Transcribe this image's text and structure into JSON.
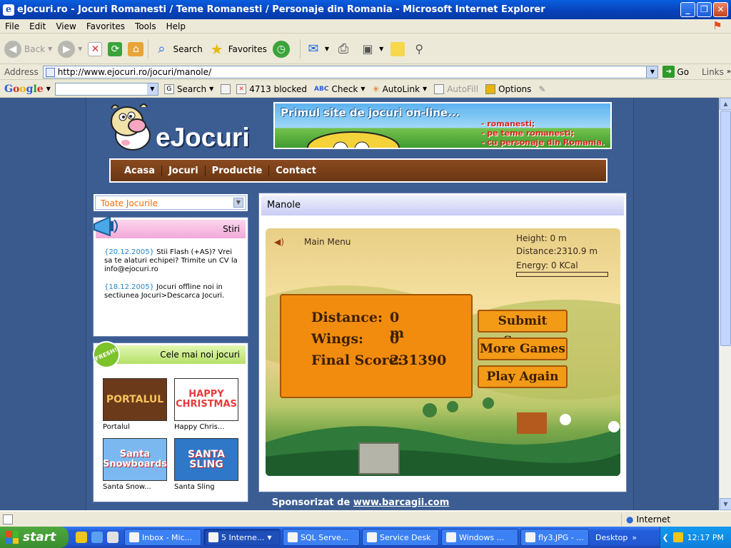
{
  "window": {
    "title": "eJocuri.ro - Jocuri Romanesti / Teme Romanesti / Personaje din Romania - Microsoft Internet Explorer"
  },
  "menu": [
    "File",
    "Edit",
    "View",
    "Favorites",
    "Tools",
    "Help"
  ],
  "toolbar": {
    "back": "Back",
    "search": "Search",
    "favorites": "Favorites"
  },
  "address": {
    "label": "Address",
    "url": "http://www.ejocuri.ro/jocuri/manole/",
    "go": "Go",
    "links": "Links"
  },
  "google": {
    "logo": "Google",
    "search": "Search",
    "blocked": "4713 blocked",
    "check": "Check",
    "autolink": "AutoLink",
    "autofill": "AutoFill",
    "options": "Options"
  },
  "site": {
    "logo": "eJocuri",
    "banner_title": "Primul site de jocuri on-line...",
    "banner_lines": [
      "- romanesti;",
      "- pe teme romanesti;",
      "- cu personaje din Romania."
    ],
    "nav": [
      "Acasa",
      "Jocuri",
      "Productie",
      "Contact"
    ],
    "dropdown": "Toate Jocurile",
    "news": {
      "title": "Stiri",
      "items": [
        {
          "date": "{20.12.2005}",
          "text": " Stii Flash (+AS)? Vrei sa te alaturi echipei? Trimite un CV la info@ejocuri.ro"
        },
        {
          "date": "{18.12.2005}",
          "text": " Jocuri offline noi in sectiunea Jocuri>Descarca Jocuri."
        }
      ]
    },
    "newest": {
      "title": "Cele mai noi jocuri",
      "badge": "FRESH!",
      "games": [
        {
          "label": "Portalul",
          "thumb": "PORTALUL",
          "color": "#6b3a1a"
        },
        {
          "label": "Happy Chris...",
          "thumb": "HAPPY CHRISTMAS",
          "color": "#e83a3a"
        },
        {
          "label": "Santa Snow...",
          "thumb": "Santa Snowboards",
          "color": "#d8323a"
        },
        {
          "label": "Santa Sling",
          "thumb": "SANTA SLING",
          "color": "#2f78c8"
        }
      ]
    },
    "game": {
      "title": "Manole",
      "main_menu": "Main Menu",
      "height": "Height:   0 m",
      "distance_hud": "Distance:2310.9 m",
      "energy": "Energy:  0 KCal",
      "distance_label": "Distance:",
      "distance_value": "0 m",
      "wings_label": "Wings:",
      "wings_value": "0",
      "score_label": "Final Score:",
      "score_value": "231390",
      "btn_submit": "Submit Score",
      "btn_more": "More Games",
      "btn_play": "Play Again"
    },
    "sponsor_prefix": "Sponsorizat de ",
    "sponsor_link": "www.barcagii.com"
  },
  "status": {
    "zone": "Internet"
  },
  "taskbar": {
    "start": "start",
    "tasks": [
      "Inbox - Mic...",
      "5 Interne...",
      "SQL Serve...",
      "Service Desk",
      "Windows ...",
      "fly3.JPG - ..."
    ],
    "desktop": "Desktop",
    "clock": "12:17 PM"
  }
}
